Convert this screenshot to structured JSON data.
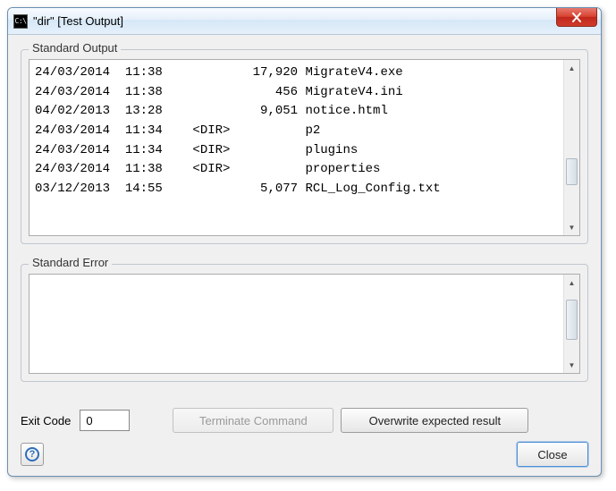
{
  "titlebar": {
    "icon_text": "C:\\",
    "title": "\"dir\" [Test Output]"
  },
  "stdout": {
    "group_label": "Standard Output",
    "rows": [
      {
        "date": "24/03/2014",
        "time": "11:38",
        "dir": "",
        "size": "17,920",
        "name": "MigrateV4.exe"
      },
      {
        "date": "24/03/2014",
        "time": "11:38",
        "dir": "",
        "size": "456",
        "name": "MigrateV4.ini"
      },
      {
        "date": "04/02/2013",
        "time": "13:28",
        "dir": "",
        "size": "9,051",
        "name": "notice.html"
      },
      {
        "date": "24/03/2014",
        "time": "11:34",
        "dir": "<DIR>",
        "size": "",
        "name": "p2"
      },
      {
        "date": "24/03/2014",
        "time": "11:34",
        "dir": "<DIR>",
        "size": "",
        "name": "plugins"
      },
      {
        "date": "24/03/2014",
        "time": "11:38",
        "dir": "<DIR>",
        "size": "",
        "name": "properties"
      },
      {
        "date": "03/12/2013",
        "time": "14:55",
        "dir": "",
        "size": "5,077",
        "name": "RCL_Log_Config.txt"
      }
    ]
  },
  "stderr": {
    "group_label": "Standard Error",
    "text": ""
  },
  "footer": {
    "exit_label": "Exit Code",
    "exit_value": "0",
    "terminate_label": "Terminate Command",
    "overwrite_label": "Overwrite expected result",
    "close_label": "Close",
    "help_glyph": "?"
  }
}
